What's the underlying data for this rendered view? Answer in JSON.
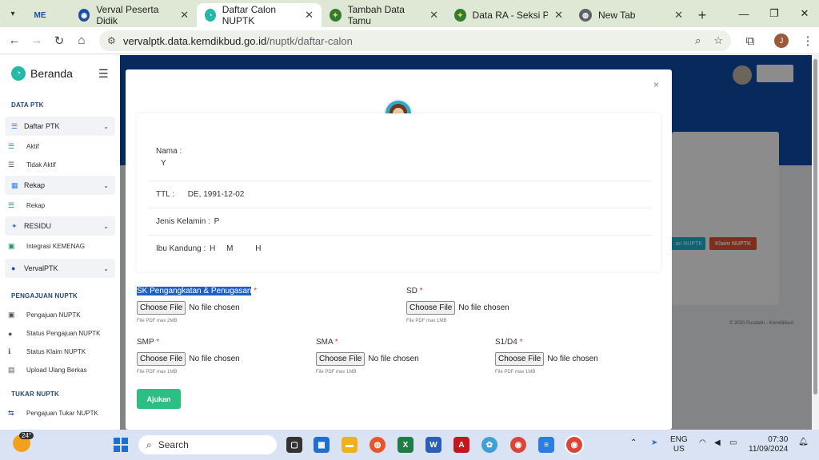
{
  "browser": {
    "tabs": [
      {
        "label": "Verval Peserta Didik",
        "fav": "globe-icon",
        "active": false
      },
      {
        "label": "Daftar Calon NUPTK",
        "fav": "app-icon",
        "active": true
      },
      {
        "label": "Tambah Data Tamu",
        "fav": "kemenag-icon",
        "active": false
      },
      {
        "label": "Data RA - Seksi Pendidi",
        "fav": "kemenag-icon",
        "active": false
      },
      {
        "label": "New Tab",
        "fav": "chrome-icon",
        "active": false
      }
    ],
    "first_tab_fav": "ME",
    "url_host": "vervalptk.data.kemdikbud.go.id",
    "url_path": "/nuptk/daftar-calon",
    "profile_initial": "J"
  },
  "sidebar": {
    "brand": "Beranda",
    "sections": {
      "data_ptk": "DATA PTK",
      "pengajuan": "PENGAJUAN NUPTK",
      "tukar": "TUKAR NUPTK"
    },
    "daftar_ptk": "Daftar PTK",
    "aktif": "Aktif",
    "tidak_aktif": "Tidak Aktif",
    "rekap_group": "Rekap",
    "rekap": "Rekap",
    "residu": "RESIDU",
    "integrasi": "Integrasi KEMENAG",
    "vervalptk": "VervalPTK",
    "pengajuan_nuptk": "Pengajuan NUPTK",
    "status_pengajuan": "Status Pengajuan NUPTK",
    "status_klaim": "Status Klaim NUPTK",
    "upload_ulang": "Upload Ulang Berkas",
    "pengajuan_tukar": "Pengajuan Tukar NUPTK"
  },
  "background": {
    "btn_cyan": "an NUPTK",
    "btn_red": "Klaim NUPTK",
    "footer": "© 2020 Pusdatin - Kemdikbud"
  },
  "modal": {
    "close": "×",
    "nama_label": "Nama :",
    "nama_value": "Y",
    "ttl_label": "TTL :",
    "ttl_value": "DE, 1991-12-02",
    "jk_label": "Jenis Kelamin :",
    "jk_value": "P",
    "ibu_label": "Ibu Kandung :",
    "ibu_value": "H     M          H",
    "fields": {
      "sk": {
        "label": "SK Pengangkatan & Penugasan",
        "hint": "File PDF max 2MB"
      },
      "sd": {
        "label": "SD",
        "hint": "File PDF max 1MB"
      },
      "smp": {
        "label": "SMP",
        "hint": "File PDF max 1MB"
      },
      "sma": {
        "label": "SMA",
        "hint": "File PDF max 1MB"
      },
      "s1": {
        "label": "S1/D4",
        "hint": "File PDF max 1MB"
      }
    },
    "required_mark": "*",
    "choose_file": "Choose File",
    "no_file": "No file chosen",
    "submit": "Ajukan"
  },
  "taskbar": {
    "temp": "24°",
    "search": "Search",
    "lang1": "ENG",
    "lang2": "US",
    "time": "07:30",
    "date": "11/09/2024"
  }
}
